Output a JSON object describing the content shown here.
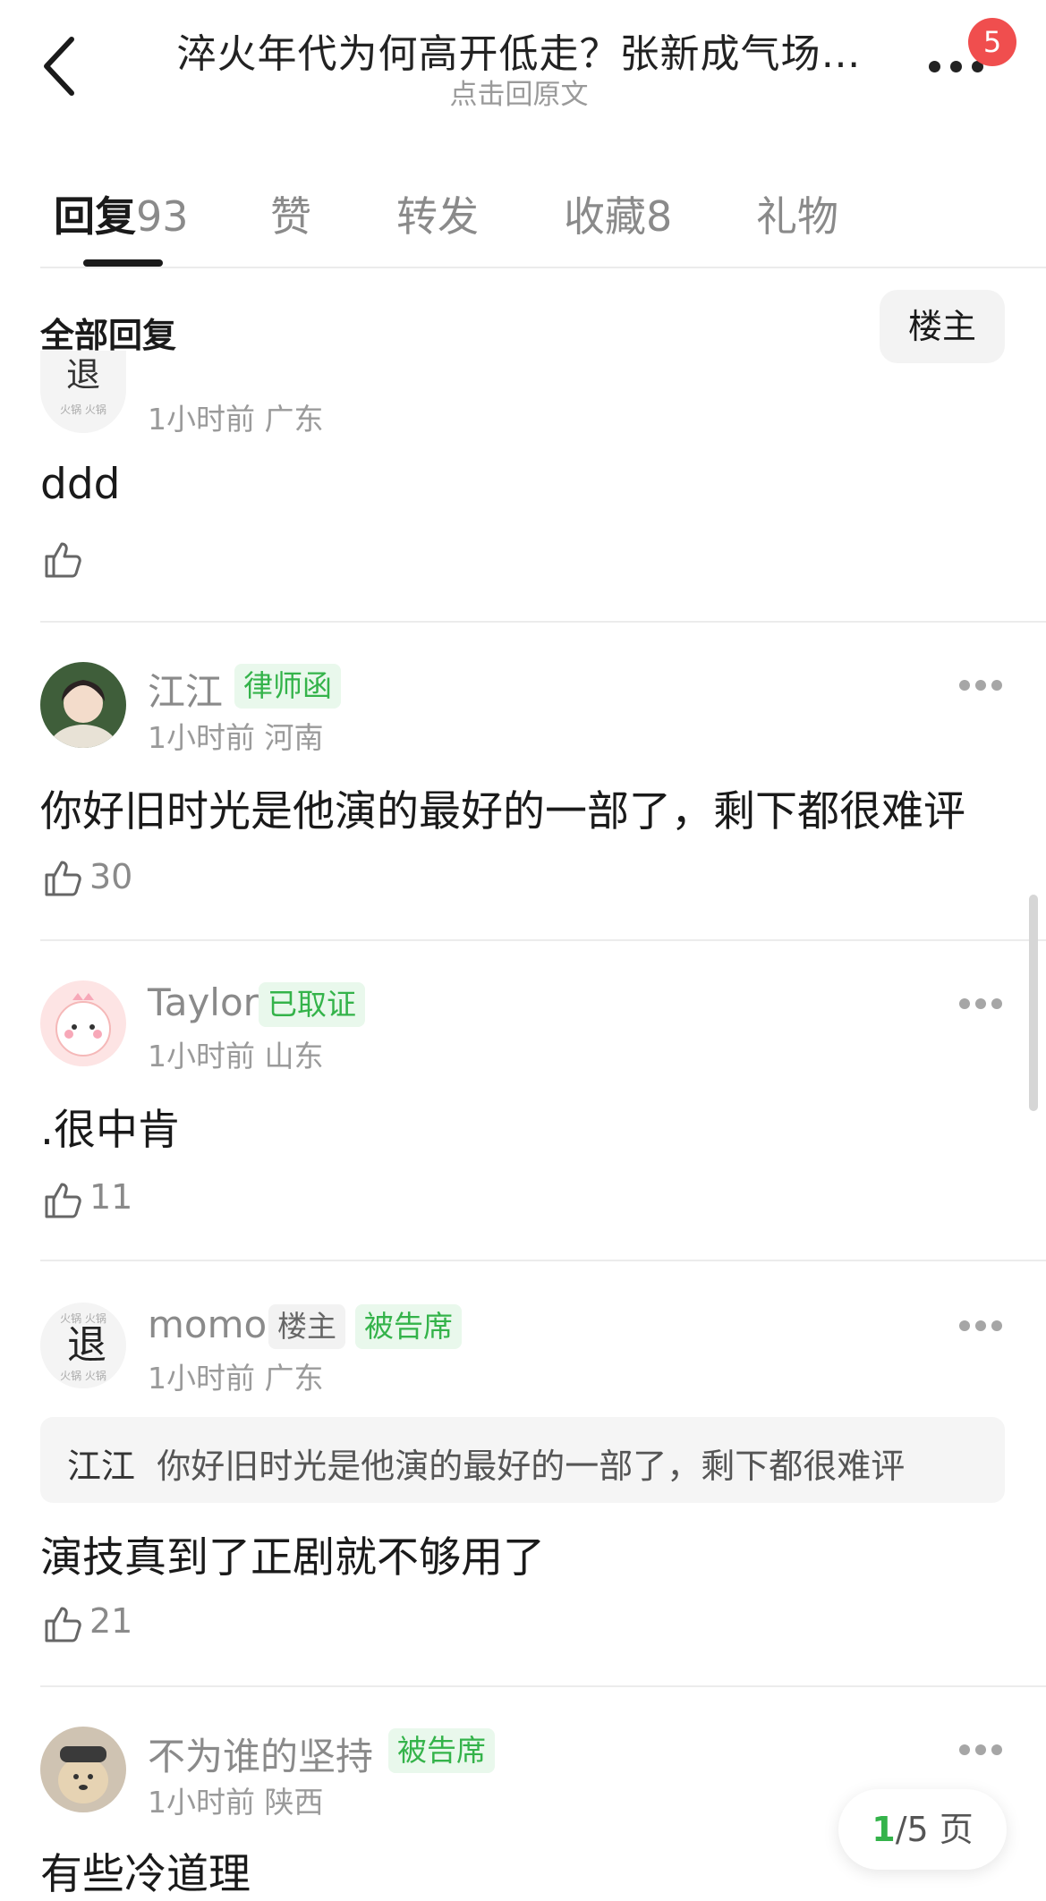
{
  "header": {
    "title": "淬火年代为何高开低走？张新成气场…",
    "subtitle": "点击回原文",
    "notification_count": "5"
  },
  "tabs": [
    {
      "label": "回复",
      "count": "93"
    },
    {
      "label": "赞",
      "count": ""
    },
    {
      "label": "转发",
      "count": ""
    },
    {
      "label": "收藏",
      "count": "8"
    },
    {
      "label": "礼物",
      "count": ""
    }
  ],
  "section": {
    "title": "全部回复",
    "filter_label": "楼主"
  },
  "comments": [
    {
      "username": "",
      "tags": [],
      "time": "1小时前",
      "location": "广东",
      "body": "ddd",
      "likes": ""
    },
    {
      "username": "江江",
      "tags": [
        "律师函"
      ],
      "time": "1小时前",
      "location": "河南",
      "body": "你好旧时光是他演的最好的一部了，剩下都很难评",
      "likes": "30"
    },
    {
      "username": "Taylor",
      "tags": [
        "已取证"
      ],
      "time": "1小时前",
      "location": "山东",
      "body": ".很中肯",
      "likes": "11"
    },
    {
      "username": "momo",
      "tags": [
        "楼主",
        "被告席"
      ],
      "time": "1小时前",
      "location": "广东",
      "quote_user": "江江",
      "quote_text": "你好旧时光是他演的最好的一部了，剩下都很难评",
      "body": "演技真到了正剧就不够用了",
      "likes": "21"
    },
    {
      "username": "不为谁的坚持",
      "tags": [
        "被告席"
      ],
      "time": "1小时前",
      "location": "陕西",
      "body": "有些冷道理",
      "likes": ""
    }
  ],
  "pagination": {
    "current": "1",
    "total": "/5 页"
  },
  "colors": {
    "accent_green": "#34b34a",
    "tag_green_bg": "#e9f8ec",
    "badge_red": "#f04e4e"
  }
}
